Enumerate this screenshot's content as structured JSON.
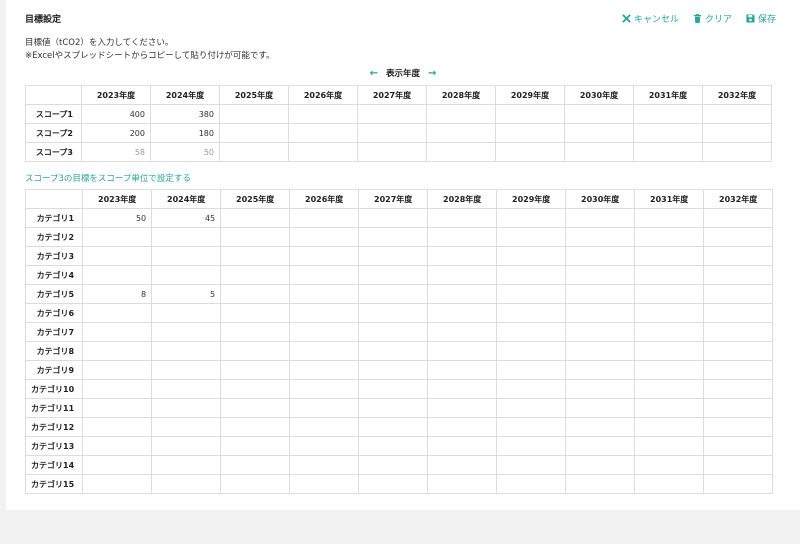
{
  "header": {
    "title": "目標設定",
    "actions": {
      "cancel": "キャンセル",
      "clear": "クリア",
      "save": "保存"
    }
  },
  "description": {
    "line1": "目標値（tCO2）を入力してください。",
    "line2": "※Excelやスプレッドシートからコピーして貼り付けが可能です。"
  },
  "year_nav": {
    "label": "表示年度",
    "prev": "←",
    "next": "→"
  },
  "years": [
    "2023年度",
    "2024年度",
    "2025年度",
    "2026年度",
    "2027年度",
    "2028年度",
    "2029年度",
    "2030年度",
    "2031年度",
    "2032年度"
  ],
  "scope_table": {
    "rows": [
      {
        "label": "スコープ1",
        "values": [
          "400",
          "380",
          "",
          "",
          "",
          "",
          "",
          "",
          "",
          ""
        ]
      },
      {
        "label": "スコープ2",
        "values": [
          "200",
          "180",
          "",
          "",
          "",
          "",
          "",
          "",
          "",
          ""
        ]
      },
      {
        "label": "スコープ3",
        "values": [
          "58",
          "50",
          "",
          "",
          "",
          "",
          "",
          "",
          "",
          ""
        ],
        "muted": true
      }
    ]
  },
  "scope3_link": "スコープ3の目標をスコープ単位で設定する",
  "category_table": {
    "rows": [
      {
        "label": "カテゴリ1",
        "values": [
          "50",
          "45",
          "",
          "",
          "",
          "",
          "",
          "",
          "",
          ""
        ]
      },
      {
        "label": "カテゴリ2",
        "values": [
          "",
          "",
          "",
          "",
          "",
          "",
          "",
          "",
          "",
          ""
        ]
      },
      {
        "label": "カテゴリ3",
        "values": [
          "",
          "",
          "",
          "",
          "",
          "",
          "",
          "",
          "",
          ""
        ]
      },
      {
        "label": "カテゴリ4",
        "values": [
          "",
          "",
          "",
          "",
          "",
          "",
          "",
          "",
          "",
          ""
        ]
      },
      {
        "label": "カテゴリ5",
        "values": [
          "8",
          "5",
          "",
          "",
          "",
          "",
          "",
          "",
          "",
          ""
        ]
      },
      {
        "label": "カテゴリ6",
        "values": [
          "",
          "",
          "",
          "",
          "",
          "",
          "",
          "",
          "",
          ""
        ]
      },
      {
        "label": "カテゴリ7",
        "values": [
          "",
          "",
          "",
          "",
          "",
          "",
          "",
          "",
          "",
          ""
        ]
      },
      {
        "label": "カテゴリ8",
        "values": [
          "",
          "",
          "",
          "",
          "",
          "",
          "",
          "",
          "",
          ""
        ]
      },
      {
        "label": "カテゴリ9",
        "values": [
          "",
          "",
          "",
          "",
          "",
          "",
          "",
          "",
          "",
          ""
        ]
      },
      {
        "label": "カテゴリ10",
        "values": [
          "",
          "",
          "",
          "",
          "",
          "",
          "",
          "",
          "",
          ""
        ]
      },
      {
        "label": "カテゴリ11",
        "values": [
          "",
          "",
          "",
          "",
          "",
          "",
          "",
          "",
          "",
          ""
        ]
      },
      {
        "label": "カテゴリ12",
        "values": [
          "",
          "",
          "",
          "",
          "",
          "",
          "",
          "",
          "",
          ""
        ]
      },
      {
        "label": "カテゴリ13",
        "values": [
          "",
          "",
          "",
          "",
          "",
          "",
          "",
          "",
          "",
          ""
        ]
      },
      {
        "label": "カテゴリ14",
        "values": [
          "",
          "",
          "",
          "",
          "",
          "",
          "",
          "",
          "",
          ""
        ]
      },
      {
        "label": "カテゴリ15",
        "values": [
          "",
          "",
          "",
          "",
          "",
          "",
          "",
          "",
          "",
          ""
        ]
      }
    ]
  },
  "colors": {
    "accent": "#2aa39a",
    "border": "#dcdcdc",
    "muted_text": "#999999"
  }
}
